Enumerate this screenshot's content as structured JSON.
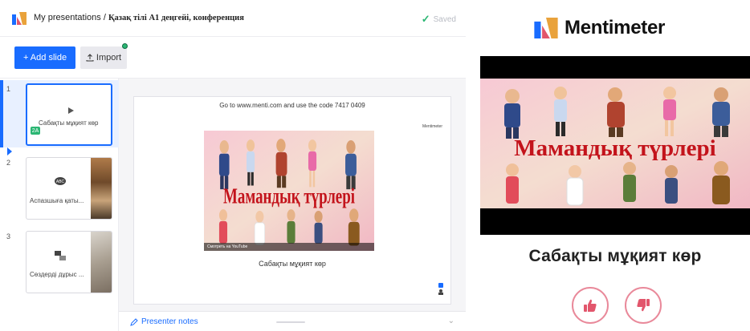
{
  "editor": {
    "breadcrumb": {
      "root": "My presentations",
      "separator": " / ",
      "current": "Қазақ тілі А1 деңгейі, конференция"
    },
    "saved_label": "Saved",
    "toolbar": {
      "add_slide_label": "+ Add slide",
      "import_label": "Import"
    },
    "slides": [
      {
        "number": "1",
        "label": "Сабақты мұқият көр",
        "badge": "2A",
        "active": true
      },
      {
        "number": "2",
        "label": "Аспазшыға қаты...",
        "active": false
      },
      {
        "number": "3",
        "label": "Сөздерді дұрыс ...",
        "active": false
      }
    ],
    "canvas": {
      "join_text": "Go to www.menti.com and use the code 7417 0409",
      "brand": "Mentimeter",
      "video_title": "Мамандық түрлері",
      "video_bar_text": "Смотреть на YouTube",
      "slide_title": "Сабақты мұқият көр"
    },
    "presenter_notes_label": "Presenter notes"
  },
  "participant": {
    "brand_name": "Mentimeter",
    "video_title": "Мамандық түрлері",
    "slide_heading": "Сабақты мұқият көр",
    "like_icon": "thumbs-up-icon",
    "dislike_icon": "thumbs-down-icon"
  },
  "colors": {
    "accent": "#196cff",
    "success": "#2bb673",
    "video_title": "#c3131b",
    "vote_border": "#e9899a",
    "vote_icon": "#e2566c"
  }
}
